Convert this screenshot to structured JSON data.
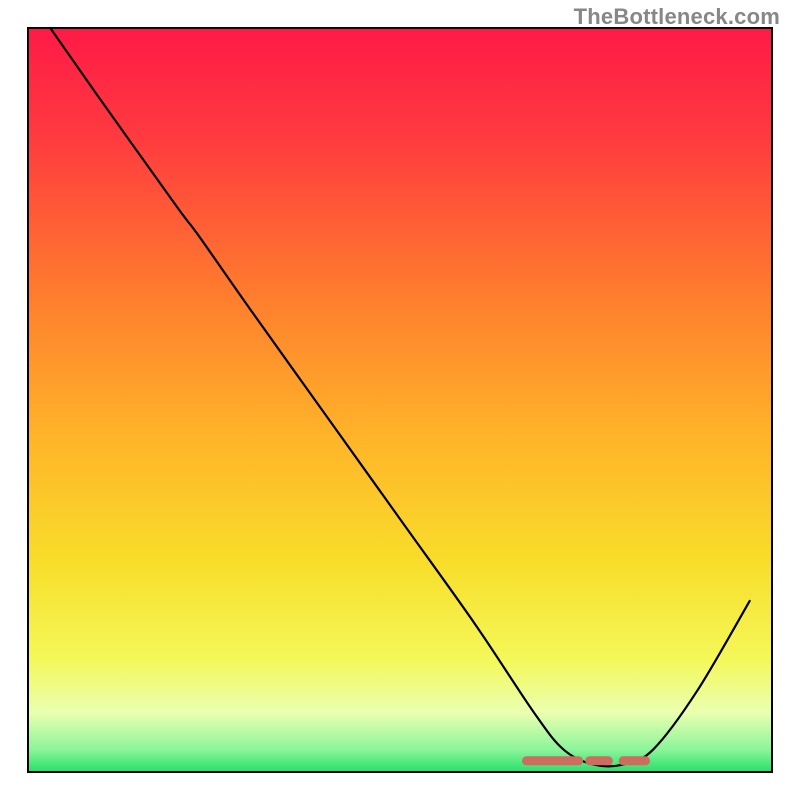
{
  "watermark": "TheBottleneck.com",
  "chart_data": {
    "type": "line",
    "title": "",
    "xlabel": "",
    "ylabel": "",
    "xlim": [
      0,
      100
    ],
    "ylim": [
      0,
      100
    ],
    "series": [
      {
        "name": "bottleneck-curve",
        "x": [
          3,
          10,
          20,
          23,
          30,
          40,
          50,
          60,
          68,
          72,
          76,
          80,
          84,
          90,
          97
        ],
        "y": [
          100,
          90,
          76,
          72,
          62,
          48,
          34,
          20,
          8,
          3,
          1,
          1,
          3,
          11,
          23
        ]
      }
    ],
    "marker_band": {
      "name": "optimal-zone-markers",
      "x_start": 67,
      "x_end": 83,
      "y": 1.5,
      "color": "#cf6b5f"
    },
    "background": {
      "type": "vertical-gradient",
      "stops": [
        {
          "pos": 0.0,
          "color": "#ff1a47"
        },
        {
          "pos": 0.15,
          "color": "#ff3b3f"
        },
        {
          "pos": 0.35,
          "color": "#ff7a2e"
        },
        {
          "pos": 0.55,
          "color": "#ffb429"
        },
        {
          "pos": 0.72,
          "color": "#f8de2a"
        },
        {
          "pos": 0.85,
          "color": "#f4f85a"
        },
        {
          "pos": 0.92,
          "color": "#eaffb0"
        },
        {
          "pos": 0.97,
          "color": "#8bf59a"
        },
        {
          "pos": 1.0,
          "color": "#26e06a"
        }
      ]
    },
    "frame_color": "#000000"
  }
}
